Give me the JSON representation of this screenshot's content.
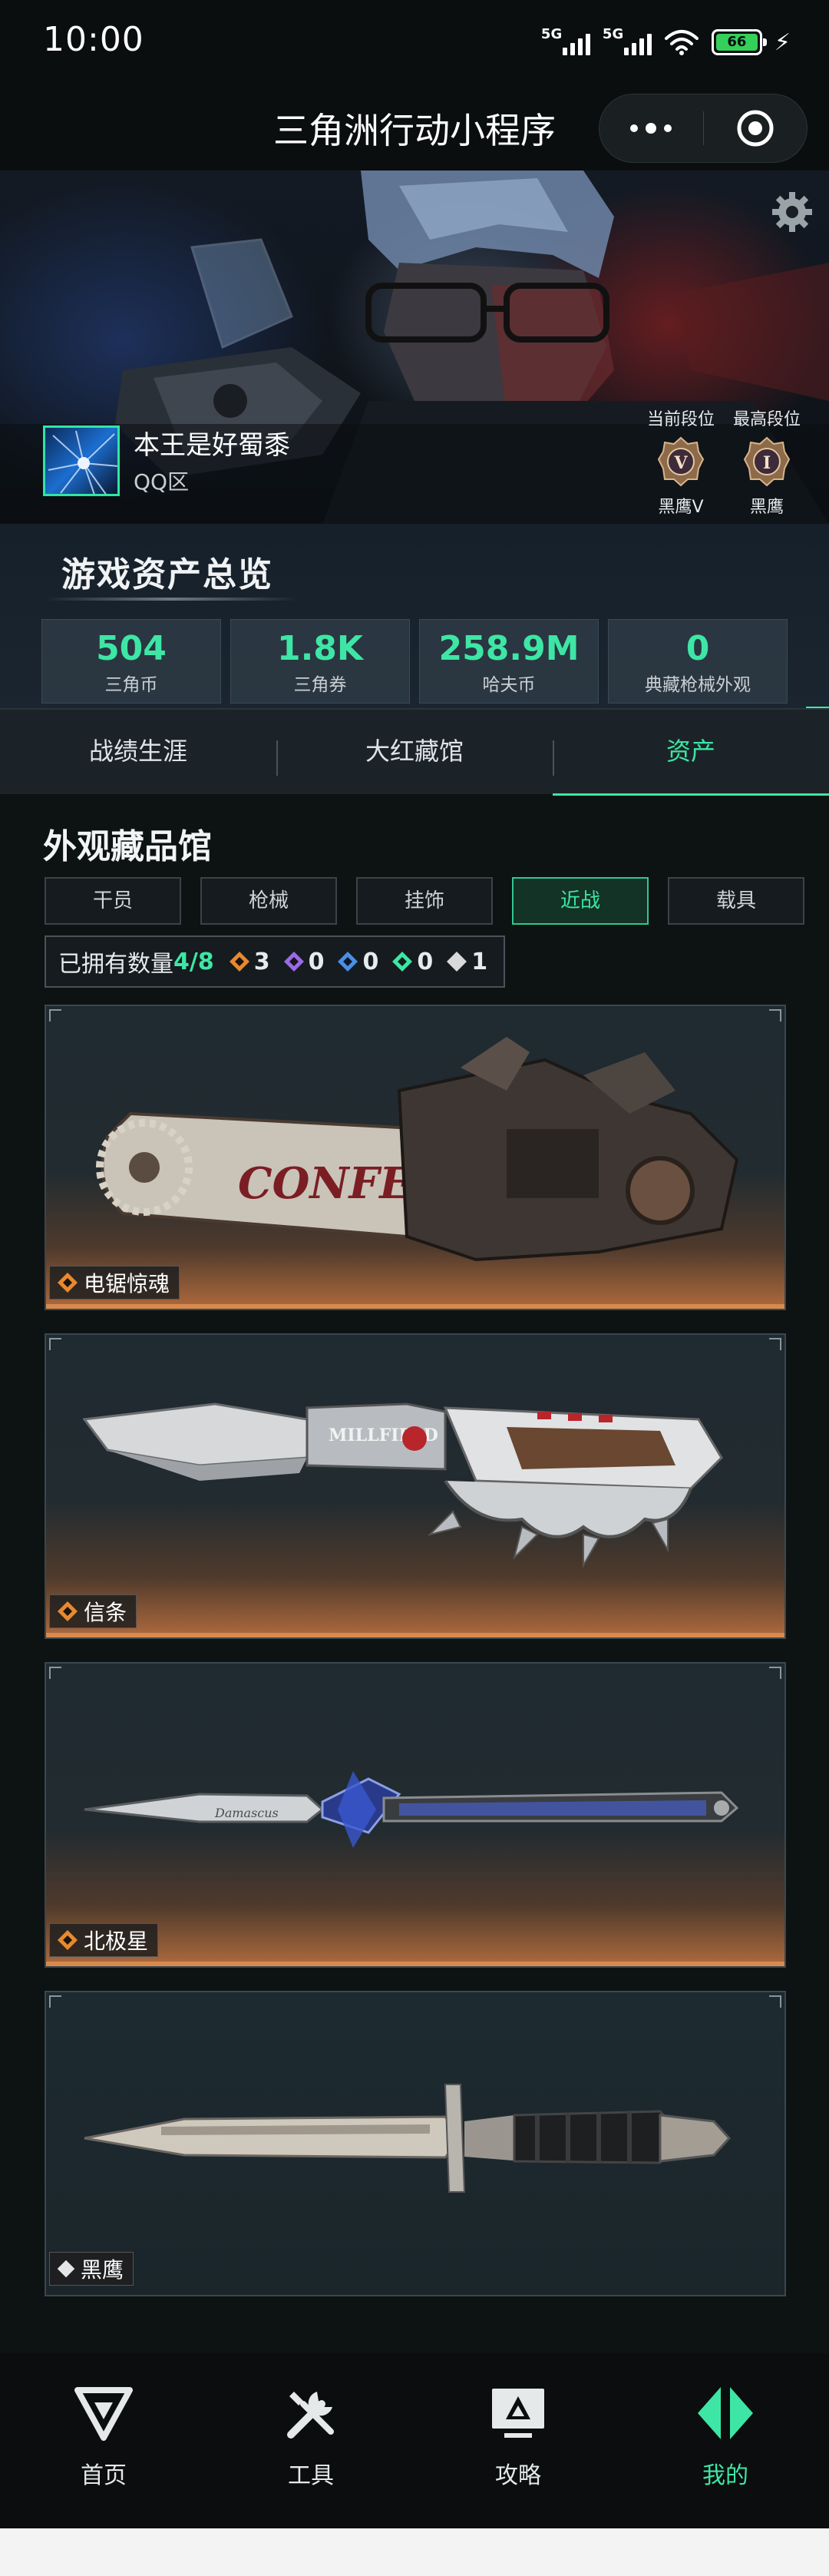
{
  "status_bar": {
    "time": "10:00",
    "net1": "5G",
    "net2": "5G",
    "battery": "66"
  },
  "nav": {
    "title": "三角洲行动小程序"
  },
  "profile": {
    "username": "本王是好蜀黍",
    "region": "QQ区",
    "current_rank_label": "当前段位",
    "current_rank": "黑鹰V",
    "highest_rank_label": "最高段位",
    "highest_rank": "黑鹰"
  },
  "overview": {
    "title": "游戏资产总览",
    "stats": [
      {
        "value": "504",
        "label": "三角币"
      },
      {
        "value": "1.8K",
        "label": "三角券"
      },
      {
        "value": "258.9M",
        "label": "哈夫币"
      },
      {
        "value": "0",
        "label": "典藏枪械外观"
      }
    ]
  },
  "tabs": [
    {
      "label": "战绩生涯"
    },
    {
      "label": "大红藏馆"
    },
    {
      "label": "资产"
    }
  ],
  "collection": {
    "title": "外观藏品馆",
    "filters": [
      {
        "label": "干员"
      },
      {
        "label": "枪械"
      },
      {
        "label": "挂饰"
      },
      {
        "label": "近战"
      },
      {
        "label": "载具"
      }
    ],
    "owned_label": "已拥有数量",
    "owned_count": "4/8",
    "rarity_counts": [
      {
        "value": "3",
        "color": "#e8892f"
      },
      {
        "value": "0",
        "color": "#9b6ae6"
      },
      {
        "value": "0",
        "color": "#4a8fe6"
      },
      {
        "value": "0",
        "color": "#3ee6a5"
      },
      {
        "value": "1",
        "color": "#d9d9d9"
      }
    ],
    "items": [
      {
        "name": "电锯惊魂",
        "art_text": "CONFESS",
        "rarity_color": "#e8892f"
      },
      {
        "name": "信条",
        "art_text": "MILLFIELD",
        "rarity_color": "#e8892f"
      },
      {
        "name": "北极星",
        "art_text": "Damascus",
        "rarity_color": "#e8892f"
      },
      {
        "name": "黑鹰",
        "art_text": "",
        "rarity_color": "#d9d9d9"
      }
    ]
  },
  "tabbar": [
    {
      "label": "首页"
    },
    {
      "label": "工具"
    },
    {
      "label": "攻略"
    },
    {
      "label": "我的"
    }
  ],
  "colors": {
    "accent": "#3ee6a5",
    "gold": "#e8892f"
  }
}
